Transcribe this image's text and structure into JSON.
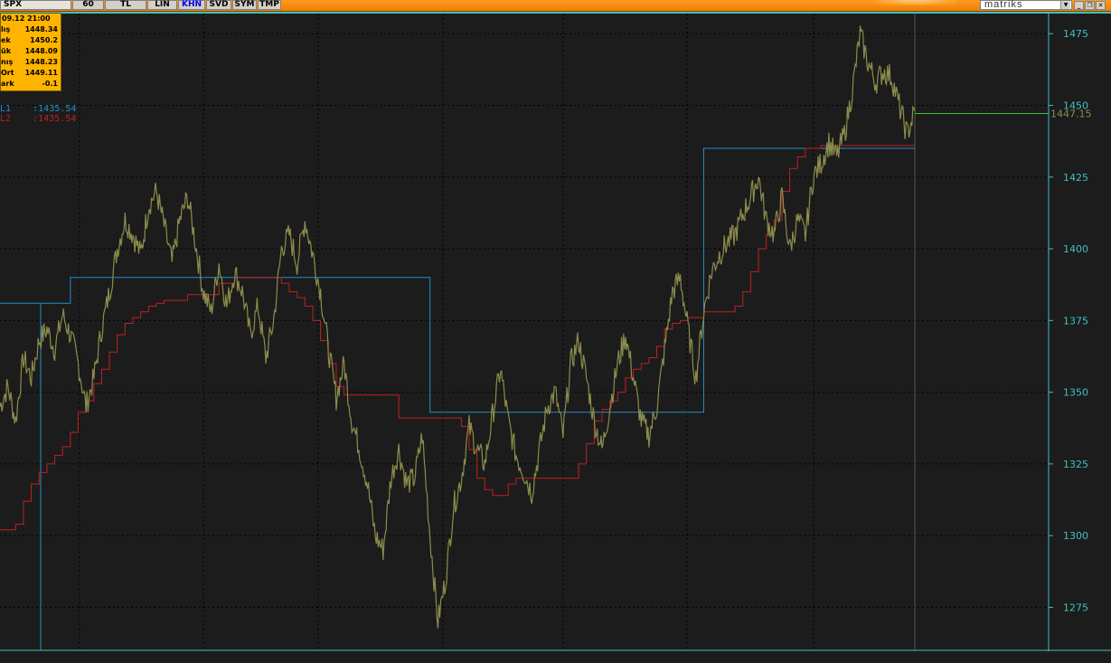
{
  "toolbar": {
    "symbol": "SPX",
    "buttons": [
      {
        "label": "60",
        "active": false
      },
      {
        "label": "TL",
        "active": false
      },
      {
        "label": "LIN",
        "active": false
      },
      {
        "label": "KHN",
        "active": true
      },
      {
        "label": "SVD",
        "active": false
      },
      {
        "label": "SYM",
        "active": false
      },
      {
        "label": "TMP",
        "active": false
      }
    ],
    "brand": "matriks",
    "window_controls": [
      "minimize-icon",
      "restore-icon",
      "close-icon"
    ]
  },
  "info_panel": {
    "timestamp": "09.12 21:00",
    "rows": [
      {
        "label": "lış",
        "value": "1448.34"
      },
      {
        "label": "ek",
        "value": "1450.2"
      },
      {
        "label": "ük",
        "value": "1448.09"
      },
      {
        "label": "nış",
        "value": "1448.23"
      },
      {
        "label": "Ort",
        "value": "1449.11"
      },
      {
        "label": "ark",
        "value": "-0.1"
      }
    ]
  },
  "legend": [
    {
      "label": "L1",
      "value": ":1435.54",
      "color": "#1e90c8"
    },
    {
      "label": "L2",
      "value": ":1435.54",
      "color": "#c02020"
    }
  ],
  "chart_data": {
    "type": "line",
    "y_axis_ticks": [
      1475,
      1450,
      1425,
      1400,
      1375,
      1350,
      1325,
      1300,
      1275
    ],
    "ylim": [
      1260,
      1482
    ],
    "last_value_label": "1447.15",
    "last_value": 1447.15,
    "colors": {
      "price": "#8c8c4c",
      "l1": "#1e90c8",
      "l2": "#c02020",
      "last": "#40c040",
      "axis": "#40c0c0",
      "grid": "#000000"
    },
    "series": [
      {
        "name": "price",
        "values": [
          1345,
          1352,
          1340,
          1362,
          1355,
          1368,
          1372,
          1365,
          1377,
          1370,
          1360,
          1345,
          1355,
          1372,
          1385,
          1400,
          1410,
          1405,
          1398,
          1415,
          1420,
          1408,
          1395,
          1410,
          1418,
          1402,
          1385,
          1378,
          1395,
          1380,
          1392,
          1385,
          1370,
          1380,
          1362,
          1375,
          1400,
          1405,
          1395,
          1410,
          1398,
          1385,
          1365,
          1348,
          1360,
          1340,
          1330,
          1318,
          1300,
          1295,
          1320,
          1330,
          1318,
          1320,
          1335,
          1300,
          1270,
          1285,
          1310,
          1320,
          1338,
          1330,
          1325,
          1342,
          1358,
          1340,
          1328,
          1322,
          1315,
          1330,
          1345,
          1350,
          1335,
          1360,
          1368,
          1355,
          1340,
          1330,
          1345,
          1360,
          1370,
          1355,
          1340,
          1335,
          1345,
          1365,
          1385,
          1390,
          1372,
          1355,
          1378,
          1392,
          1398,
          1402,
          1405,
          1412,
          1418,
          1425,
          1410,
          1405,
          1418,
          1400,
          1410,
          1405,
          1425,
          1430,
          1437,
          1432,
          1440,
          1455,
          1475,
          1465,
          1458,
          1462,
          1460,
          1450,
          1440,
          1448
        ]
      },
      {
        "name": "L1",
        "values": [
          1381,
          1381,
          1381,
          1381,
          1381,
          1381,
          1381,
          1381,
          1381,
          1390,
          1390,
          1390,
          1390,
          1390,
          1390,
          1390,
          1390,
          1390,
          1390,
          1390,
          1390,
          1390,
          1390,
          1390,
          1390,
          1390,
          1390,
          1390,
          1390,
          1390,
          1390,
          1390,
          1390,
          1390,
          1390,
          1390,
          1390,
          1390,
          1390,
          1390,
          1390,
          1390,
          1390,
          1390,
          1390,
          1390,
          1390,
          1390,
          1390,
          1390,
          1390,
          1390,
          1390,
          1390,
          1390,
          1343,
          1343,
          1343,
          1343,
          1343,
          1343,
          1343,
          1343,
          1343,
          1343,
          1343,
          1343,
          1343,
          1343,
          1343,
          1343,
          1343,
          1343,
          1343,
          1343,
          1343,
          1343,
          1343,
          1343,
          1343,
          1343,
          1343,
          1343,
          1343,
          1343,
          1343,
          1343,
          1343,
          1343,
          1343,
          1435,
          1435,
          1435,
          1435,
          1435,
          1435,
          1435,
          1435,
          1435,
          1435,
          1435,
          1435,
          1435,
          1435,
          1435,
          1435,
          1435,
          1435,
          1435,
          1435,
          1435,
          1435,
          1435,
          1435,
          1435,
          1435,
          1435,
          1435
        ]
      },
      {
        "name": "L2",
        "values": [
          1302,
          1302,
          1304,
          1312,
          1318,
          1322,
          1325,
          1328,
          1331,
          1336,
          1343,
          1347,
          1353,
          1358,
          1364,
          1370,
          1374,
          1376,
          1378,
          1380,
          1381,
          1382,
          1382,
          1382,
          1384,
          1384,
          1384,
          1384,
          1388,
          1388,
          1390,
          1390,
          1390,
          1390,
          1390,
          1390,
          1388,
          1385,
          1383,
          1380,
          1375,
          1368,
          1360,
          1352,
          1349,
          1349,
          1349,
          1349,
          1349,
          1349,
          1349,
          1341,
          1341,
          1341,
          1341,
          1341,
          1341,
          1341,
          1341,
          1338,
          1330,
          1320,
          1316,
          1314,
          1314,
          1318,
          1320,
          1320,
          1320,
          1320,
          1320,
          1320,
          1320,
          1320,
          1325,
          1332,
          1340,
          1344,
          1347,
          1350,
          1355,
          1358,
          1360,
          1362,
          1366,
          1372,
          1374,
          1375,
          1376,
          1376,
          1378,
          1378,
          1378,
          1378,
          1380,
          1385,
          1392,
          1400,
          1405,
          1410,
          1420,
          1428,
          1432,
          1435,
          1435,
          1436,
          1436,
          1436,
          1436,
          1436,
          1436,
          1436,
          1436,
          1436,
          1436,
          1436,
          1436,
          1436
        ]
      }
    ]
  }
}
